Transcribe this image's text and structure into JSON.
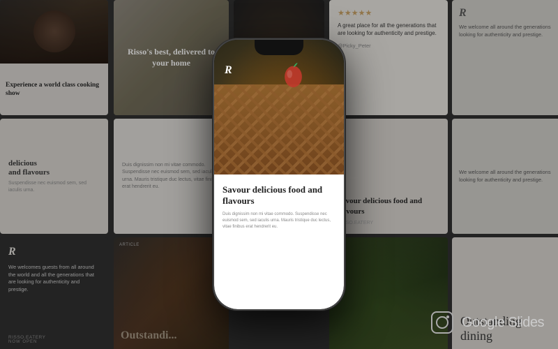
{
  "background": {
    "color": "#1e1e1e"
  },
  "cards": {
    "card1": {
      "type": "image_text",
      "title": "Experience a world class cooking show",
      "body_text": ""
    },
    "card2": {
      "type": "center_title",
      "title": "Risso's best, delivered to your home"
    },
    "card3": {
      "type": "review",
      "stars": "★★★★★",
      "body": "A great place for all the generations that are looking for authenticity and prestige.",
      "handle": "@Picky_Peter"
    },
    "card4": {
      "type": "text_only",
      "tag": "delicious",
      "subtitle": "and flavours",
      "body": "Suspendisse nec euismod urna."
    },
    "card5": {
      "type": "body_text",
      "body": "Duis dignissim non mi vitae commodo. Suspendisse nec euismod sem, sed iaculis urna. Mauris tristique duc lectus, vitae finibus erat hendrerit eu."
    },
    "card6": {
      "type": "dark_logo",
      "logo": "R",
      "text": "We welcomes guests from all around the world and all the generations that are looking for authenticity and prestige.",
      "tag": "RISSO.EATERY",
      "sub": "NOW OPEN"
    },
    "card7": {
      "type": "food_image"
    },
    "card8": {
      "type": "savour",
      "title": "Savour delicious food and flavours",
      "tag": "RISSO.EATERY"
    },
    "card9": {
      "type": "dark_logo_r",
      "logo": "R",
      "text": "We welcome all around the generations looking for authenticity and prestige."
    },
    "card10": {
      "type": "outstanding",
      "title": "Outstanding dining"
    },
    "card11": {
      "type": "article",
      "article_tag": "ARTICLE",
      "title": "Outstanding"
    }
  },
  "phone": {
    "logo": "R",
    "card_title": "Savour delicious food and flavours",
    "card_body": "Duis dignissim non mi vitae commodo. Suspendisse nec euismod sem, sed iaculis urna. Mauris tristique duc lectus, vitae finibus erat hendrerit eu."
  },
  "branding": {
    "platform": "Google Slides",
    "platform_sub": ""
  }
}
